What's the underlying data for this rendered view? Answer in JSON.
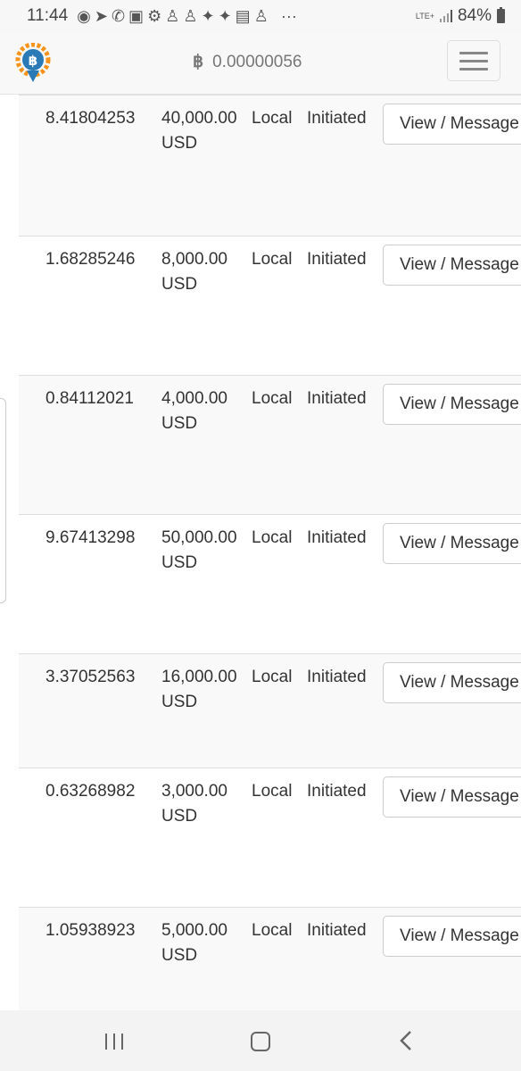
{
  "status_bar": {
    "time": "11:44",
    "network": "LTE+",
    "battery": "84%",
    "more": "···",
    "icons": [
      "spotify-icon",
      "telegram-icon",
      "chat-icon",
      "linkedin-icon",
      "settings-icon",
      "app-icon",
      "app-icon",
      "twitter-icon",
      "twitter-icon",
      "ebay-icon",
      "app-icon"
    ]
  },
  "navbar": {
    "currency_symbol": "฿",
    "balance": "0.00000056"
  },
  "trades": [
    {
      "amount": "8.41804253",
      "fiat_value": "40,000.00",
      "fiat_currency": "USD",
      "type": "Local",
      "status": "Initiated",
      "action": "View / Message"
    },
    {
      "amount": "1.68285246",
      "fiat_value": "8,000.00",
      "fiat_currency": "USD",
      "type": "Local",
      "status": "Initiated",
      "action": "View / Message"
    },
    {
      "amount": "0.84112021",
      "fiat_value": "4,000.00",
      "fiat_currency": "USD",
      "type": "Local",
      "status": "Initiated",
      "action": "View / Message"
    },
    {
      "amount": "9.67413298",
      "fiat_value": "50,000.00",
      "fiat_currency": "USD",
      "type": "Local",
      "status": "Initiated",
      "action": "View / Message"
    },
    {
      "amount": "3.37052563",
      "fiat_value": "16,000.00",
      "fiat_currency": "USD",
      "type": "Local",
      "status": "Initiated",
      "action": "View / Message"
    },
    {
      "amount": "0.63268982",
      "fiat_value": "3,000.00",
      "fiat_currency": "USD",
      "type": "Local",
      "status": "Initiated",
      "action": "View / Message"
    },
    {
      "amount": "1.05938923",
      "fiat_value": "5,000.00",
      "fiat_currency": "USD",
      "type": "Local",
      "status": "Initiated",
      "action": "View / Message"
    }
  ],
  "colors": {
    "accent": "#f7931a",
    "brand_blue": "#2a7ab8"
  }
}
